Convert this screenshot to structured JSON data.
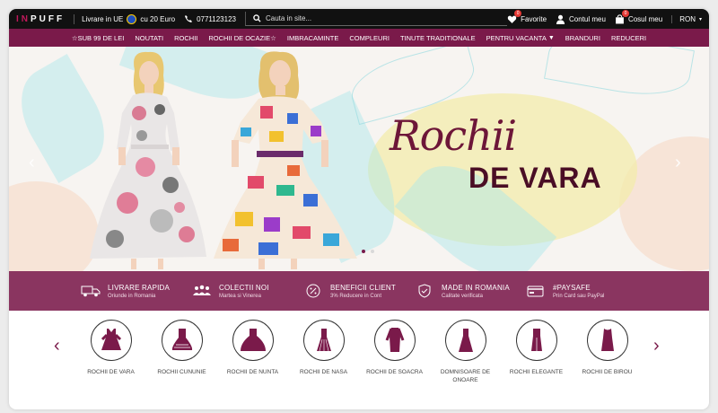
{
  "topbar": {
    "logo_in": "IN",
    "logo_puff": "PUFF",
    "shipping_text": "Livrare in UE",
    "shipping_price": "cu 20 Euro",
    "phone": "0771123123",
    "search_placeholder": "Cauta in site...",
    "favorites_label": "Favorite",
    "favorites_count": "0",
    "account_label": "Contul meu",
    "cart_label": "Cosul meu",
    "cart_count": "0",
    "currency": "RON"
  },
  "nav": {
    "items": [
      "☆SUB 99 DE LEI",
      "NOUTATI",
      "ROCHII",
      "ROCHII DE OCAZIE☆",
      "IMBRACAMINTE",
      "COMPLEURI",
      "TINUTE TRADITIONALE",
      "PENTRU VACANTA",
      "BRANDURI",
      "REDUCERI"
    ]
  },
  "hero": {
    "title_line1": "Rochii",
    "title_line2": "DE VARA",
    "slide_count": 2,
    "active_slide": 1,
    "colors": {
      "accent": "#7a1a4a",
      "title": "#6d1638"
    }
  },
  "benefits": [
    {
      "icon": "truck-icon",
      "title": "LIVRARE RAPIDA",
      "subtitle": "Oriunde in Romania"
    },
    {
      "icon": "people-icon",
      "title": "COLECTII NOI",
      "subtitle": "Martea si Vinerea"
    },
    {
      "icon": "percent-badge-icon",
      "title": "BENEFICII CLIENT",
      "subtitle": "3% Reducere in Cont"
    },
    {
      "icon": "shield-check-icon",
      "title": "MADE IN ROMANIA",
      "subtitle": "Calitate verificata"
    },
    {
      "icon": "credit-card-icon",
      "title": "#PAYSAFE",
      "subtitle": "Prin Card sau PayPal"
    }
  ],
  "categories": [
    {
      "icon": "summer-dress-icon",
      "label": "ROCHII DE VARA"
    },
    {
      "icon": "baptism-dress-icon",
      "label": "ROCHII CUNUNIE"
    },
    {
      "icon": "wedding-dress-icon",
      "label": "ROCHII DE NUNTA"
    },
    {
      "icon": "godmother-dress-icon",
      "label": "ROCHII DE NASA"
    },
    {
      "icon": "mother-in-law-dress-icon",
      "label": "ROCHII DE SOACRA"
    },
    {
      "icon": "bridesmaid-dress-icon",
      "label": "DOMNISOARE DE ONOARE"
    },
    {
      "icon": "elegant-dress-icon",
      "label": "ROCHII ELEGANTE"
    },
    {
      "icon": "office-dress-icon",
      "label": "ROCHII DE BIROU"
    }
  ]
}
